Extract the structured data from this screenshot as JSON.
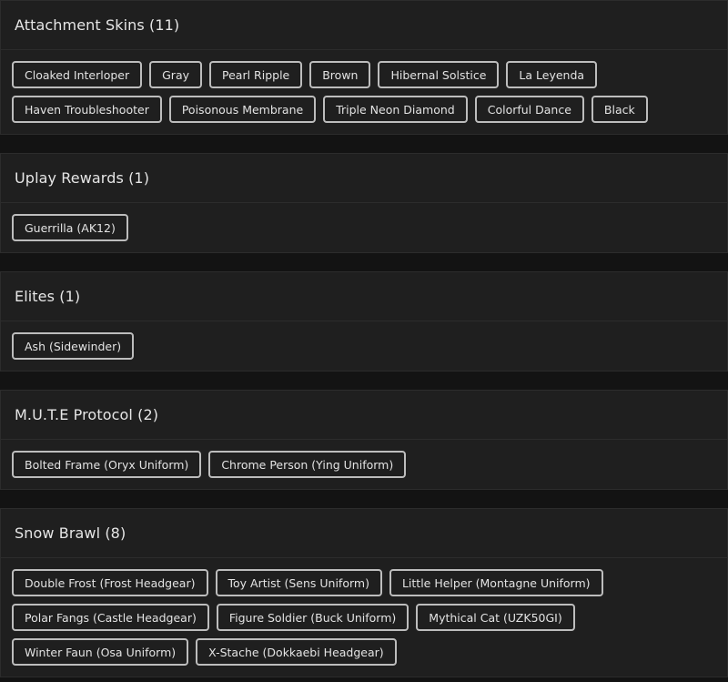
{
  "sections": [
    {
      "title": "Attachment Skins (11)",
      "items": [
        "Cloaked Interloper",
        "Gray",
        "Pearl Ripple",
        "Brown",
        "Hibernal Solstice",
        "La Leyenda",
        "Haven Troubleshooter",
        "Poisonous Membrane",
        "Triple Neon Diamond",
        "Colorful Dance",
        "Black"
      ]
    },
    {
      "title": "Uplay Rewards (1)",
      "items": [
        "Guerrilla (AK12)"
      ]
    },
    {
      "title": "Elites (1)",
      "items": [
        "Ash (Sidewinder)"
      ]
    },
    {
      "title": "M.U.T.E Protocol (2)",
      "items": [
        "Bolted Frame (Oryx Uniform)",
        "Chrome Person (Ying Uniform)"
      ]
    },
    {
      "title": "Snow Brawl (8)",
      "items": [
        "Double Frost (Frost Headgear)",
        "Toy Artist (Sens Uniform)",
        "Little Helper (Montagne Uniform)",
        "Polar Fangs (Castle Headgear)",
        "Figure Soldier (Buck Uniform)",
        "Mythical Cat (UZK50GI)",
        "Winter Faun (Osa Uniform)",
        "X-Stache (Dokkaebi Headgear)"
      ]
    }
  ]
}
